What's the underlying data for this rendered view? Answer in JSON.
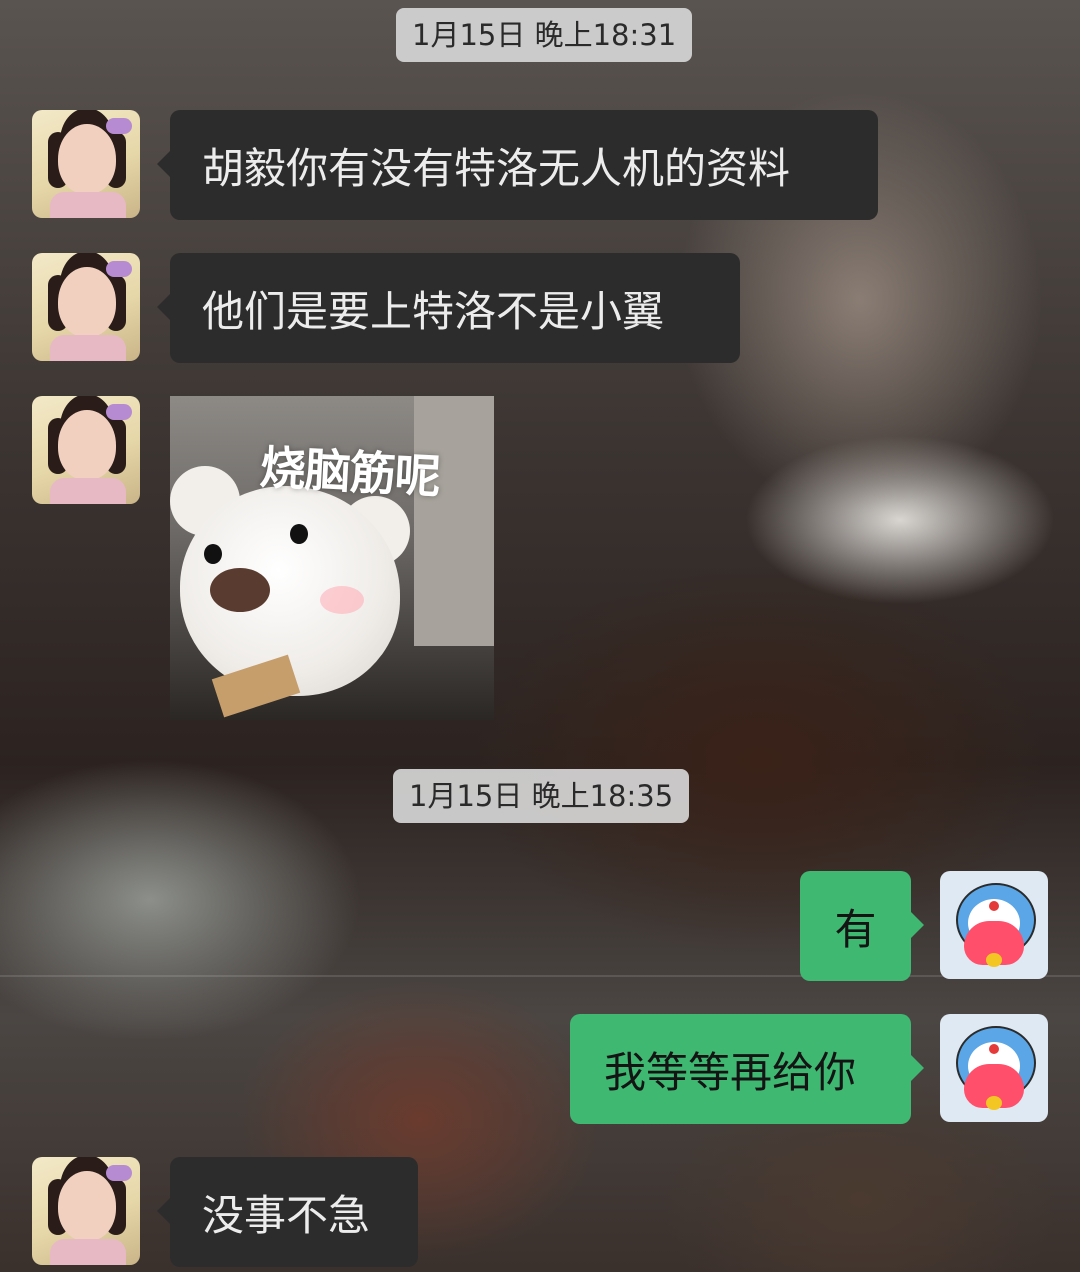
{
  "chat": {
    "timestamps": [
      "1月15日 晚上18:31",
      "1月15日 晚上18:35"
    ],
    "messages": [
      {
        "sender": "friend",
        "type": "text",
        "text": "胡毅你有没有特洛无人机的资料"
      },
      {
        "sender": "friend",
        "type": "text",
        "text": "他们是要上特洛不是小翼"
      },
      {
        "sender": "friend",
        "type": "sticker",
        "caption": "烧脑筋呢"
      },
      {
        "sender": "self",
        "type": "text",
        "text": "有"
      },
      {
        "sender": "self",
        "type": "text",
        "text": "我等等再给你"
      },
      {
        "sender": "friend",
        "type": "text",
        "text": "没事不急"
      }
    ]
  },
  "colors": {
    "incoming_bubble": "#2c2c2c",
    "outgoing_bubble": "#3fb872",
    "timestamp_chip": "#d6d6d6"
  }
}
